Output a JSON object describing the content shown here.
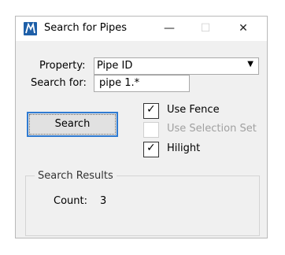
{
  "window": {
    "title": "Search for Pipes",
    "min_glyph": "—",
    "max_glyph": "☐",
    "close_glyph": "✕"
  },
  "form": {
    "property_label": "Property:",
    "property_value": "Pipe ID",
    "search_label": "Search for:",
    "search_value": "pipe 1.*"
  },
  "search_button": {
    "label": "Search"
  },
  "options": [
    {
      "label": "Use Fence",
      "checked": true,
      "enabled": true
    },
    {
      "label": "Use Selection Set",
      "checked": false,
      "enabled": false
    },
    {
      "label": "Hilight",
      "checked": true,
      "enabled": true
    }
  ],
  "results": {
    "title": "Search Results",
    "count_label": "Count:",
    "count_value": "3"
  },
  "colors": {
    "accent": "#2f7bd2",
    "app_icon": "#1e5fa8",
    "dialog_bg": "#f0f0f0"
  },
  "icons": {
    "app": "app-logo-icon",
    "dropdown": "chevron-down-icon",
    "check": "checkmark-icon"
  }
}
